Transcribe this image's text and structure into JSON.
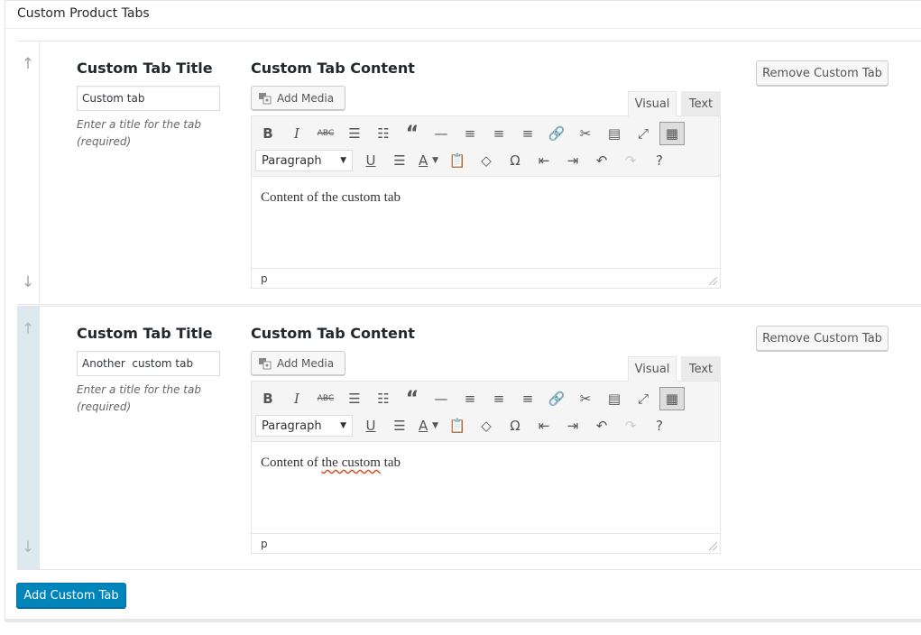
{
  "panel": {
    "title": "Custom Product Tabs",
    "add_button_label": "Add Custom Tab"
  },
  "tabs": [
    {
      "title_label": "Custom Tab Title",
      "title_value": "Custom tab",
      "title_hint": "Enter a title for the tab (required)",
      "content_label": "Custom Tab Content",
      "add_media_label": "Add Media",
      "visual_tab": "Visual",
      "text_tab": "Text",
      "format_select": "Paragraph",
      "content_text": "Content of the custom tab",
      "status_path": "p",
      "remove_label": "Remove Custom Tab"
    },
    {
      "title_label": "Custom Tab Title",
      "title_value": "Another  custom tab",
      "title_hint": "Enter a title for the tab (required)",
      "content_label": "Custom Tab Content",
      "add_media_label": "Add Media",
      "visual_tab": "Visual",
      "text_tab": "Text",
      "format_select": "Paragraph",
      "content_text_parts": [
        "Content",
        " of ",
        "the custom",
        " tab"
      ],
      "status_path": "p",
      "remove_label": "Remove Custom Tab"
    }
  ],
  "toolbar_icons_row1": [
    "bold-icon",
    "italic-icon",
    "strikethrough-icon",
    "bullet-list-icon",
    "numbered-list-icon",
    "blockquote-icon",
    "horizontal-rule-icon",
    "align-left-icon",
    "align-center-icon",
    "align-right-icon",
    "link-icon",
    "unlink-icon",
    "read-more-icon",
    "fullscreen-icon",
    "toolbar-toggle-icon"
  ],
  "toolbar_icons_row2": [
    "underline-icon",
    "justify-icon",
    "text-color-icon",
    "paste-text-icon",
    "clear-formatting-icon",
    "special-character-icon",
    "outdent-icon",
    "indent-icon",
    "undo-icon",
    "redo-icon",
    "help-icon"
  ],
  "colors": {
    "primary_button": "#0085ba",
    "drag_handle_active": "#dde8ef",
    "spellcheck_underline": "#d54e21"
  }
}
